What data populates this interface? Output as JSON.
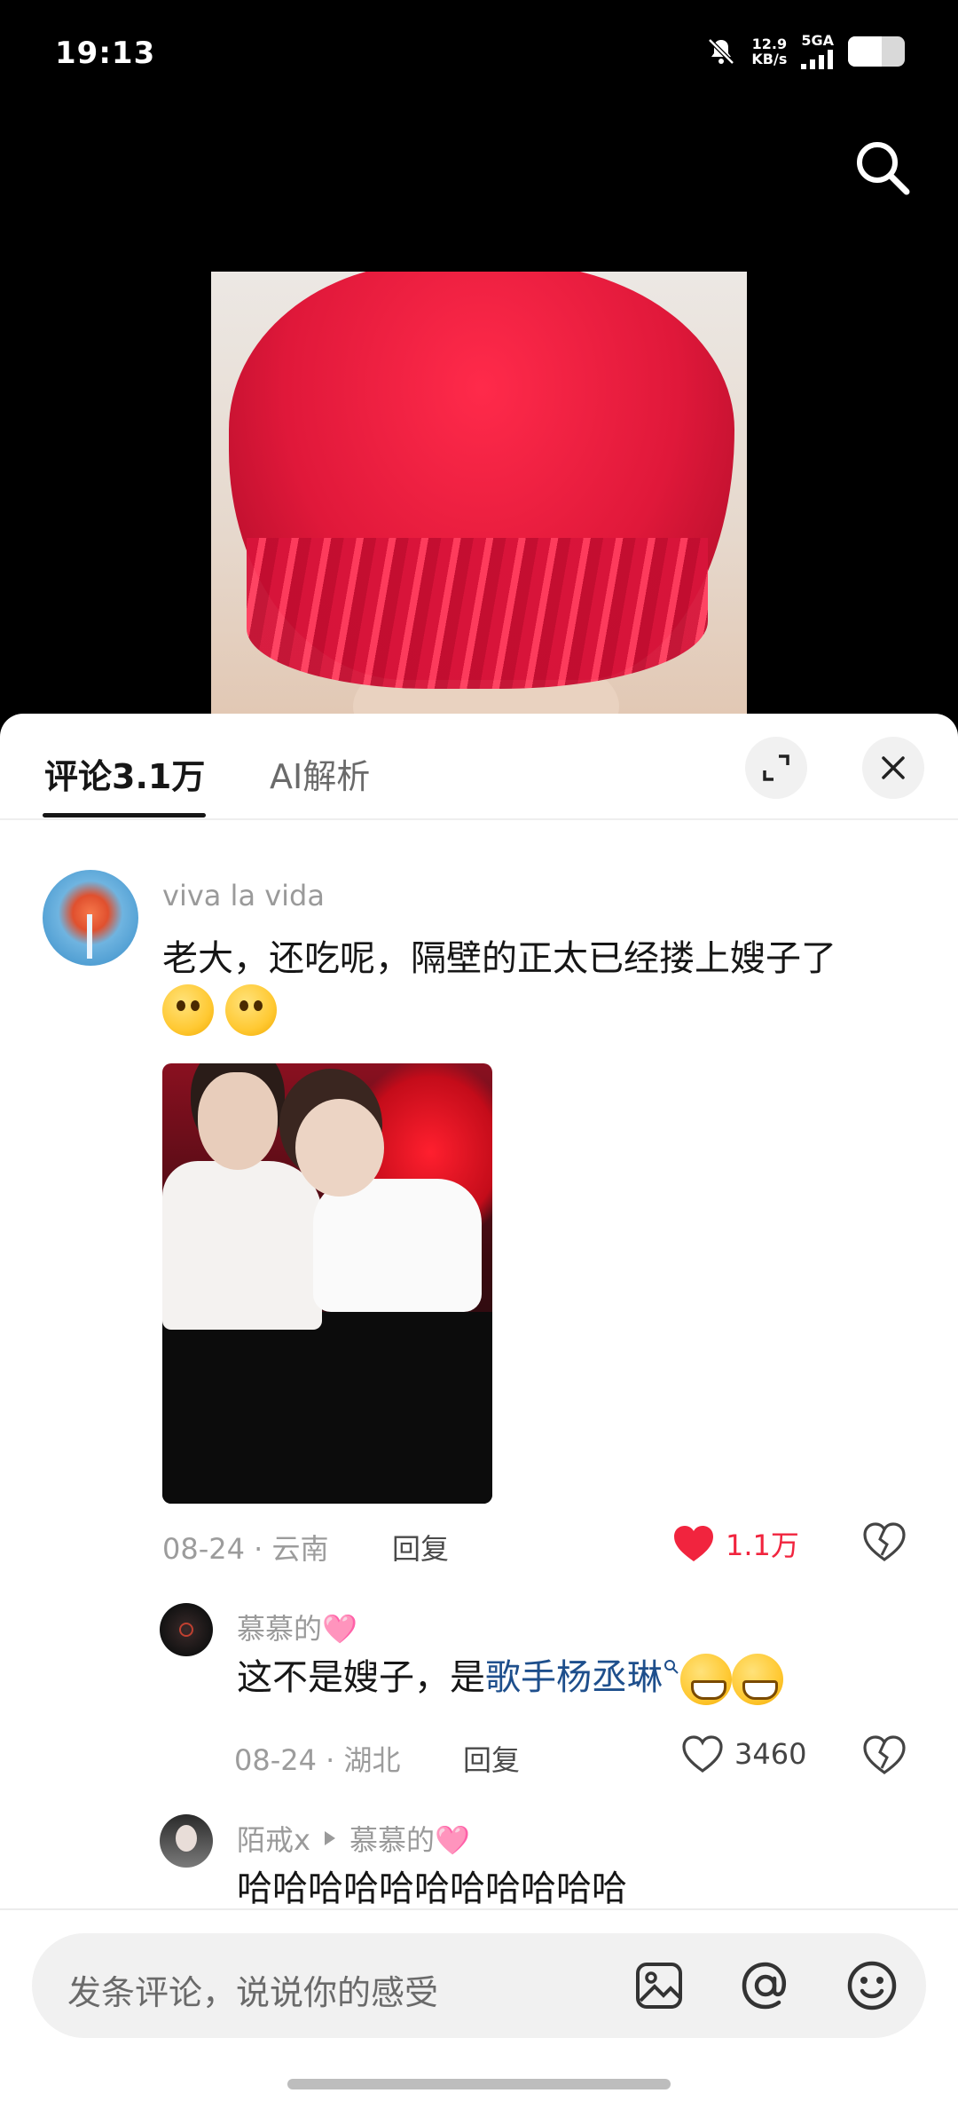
{
  "status_bar": {
    "time": "19:13",
    "net_speed_top": "12.9",
    "net_speed_unit": "KB/s",
    "network": "5GA",
    "battery_level": 0.6
  },
  "tabs": {
    "comments_label": "评论3.1万",
    "ai_label": "AI解析"
  },
  "comments": [
    {
      "username": "viva la vida",
      "text": "老大，还吃呢，隔壁的正太已经搂上嫂子了",
      "emojis": [
        "thinking-emoji",
        "thinking-emoji"
      ],
      "date": "08-24",
      "location": "云南",
      "reply_label": "回复",
      "likes": "1.1万",
      "liked": true,
      "replies": [
        {
          "username": "慕慕的🩷",
          "text_prefix": "这不是嫂子，是",
          "link_text": "歌手杨丞琳",
          "emojis": [
            "grinning-emoji",
            "grinning-emoji"
          ],
          "date": "08-24",
          "location": "湖北",
          "reply_label": "回复",
          "likes": "3460"
        },
        {
          "username": "陌戒x",
          "reply_to": "慕慕的🩷",
          "text": "哈哈哈哈哈哈哈哈哈哈哈"
        }
      ]
    }
  ],
  "input": {
    "placeholder": "发条评论，说说你的感受"
  },
  "colors": {
    "like_red": "#f1243e",
    "link_blue": "#1e4f8c",
    "sheet_bg": "#ffffff"
  }
}
